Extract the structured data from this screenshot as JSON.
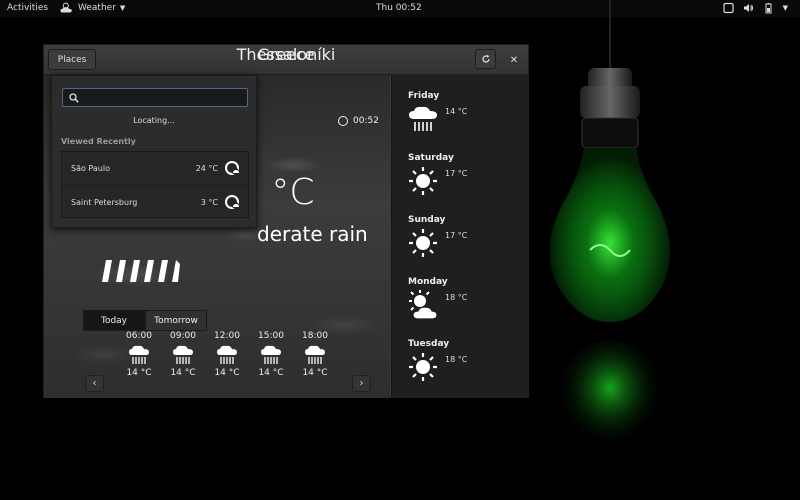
{
  "topbar": {
    "activities": "Activities",
    "app_name": "Weather",
    "clock": "Thu 00:52"
  },
  "window": {
    "places_label": "Places",
    "city": "Thessaloníki",
    "country": "Greece",
    "time": "00:52",
    "current_temp": "5 °C",
    "condition": "derate rain"
  },
  "popover": {
    "search_placeholder": "",
    "locating": "Locating...",
    "viewed_recently": "Viewed Recently",
    "recent": [
      {
        "city": "São Paulo",
        "temp": "24 °C"
      },
      {
        "city": "Saint Petersburg",
        "temp": "3 °C"
      }
    ]
  },
  "tabs": [
    {
      "label": "Today"
    },
    {
      "label": "Tomorrow"
    }
  ],
  "hourly": [
    {
      "time": "06:00",
      "temp": "14 °C",
      "icon": "rain-icon"
    },
    {
      "time": "09:00",
      "temp": "14 °C",
      "icon": "rain-icon"
    },
    {
      "time": "12:00",
      "temp": "14 °C",
      "icon": "rain-icon"
    },
    {
      "time": "15:00",
      "temp": "14 °C",
      "icon": "rain-icon"
    },
    {
      "time": "18:00",
      "temp": "14 °C",
      "icon": "rain-icon"
    }
  ],
  "forecast": [
    {
      "day": "Friday",
      "temp": "14 °C",
      "icon": "rain-icon"
    },
    {
      "day": "Saturday",
      "temp": "17 °C",
      "icon": "sun-icon"
    },
    {
      "day": "Sunday",
      "temp": "17 °C",
      "icon": "sun-icon"
    },
    {
      "day": "Monday",
      "temp": "18 °C",
      "icon": "partly-cloudy-icon"
    },
    {
      "day": "Tuesday",
      "temp": "18 °C",
      "icon": "sun-icon"
    }
  ],
  "colors": {
    "accent_bulb": "#22ff33",
    "window_bg": "#3a3a3a",
    "forecast_bg": "#1f1f1f"
  }
}
